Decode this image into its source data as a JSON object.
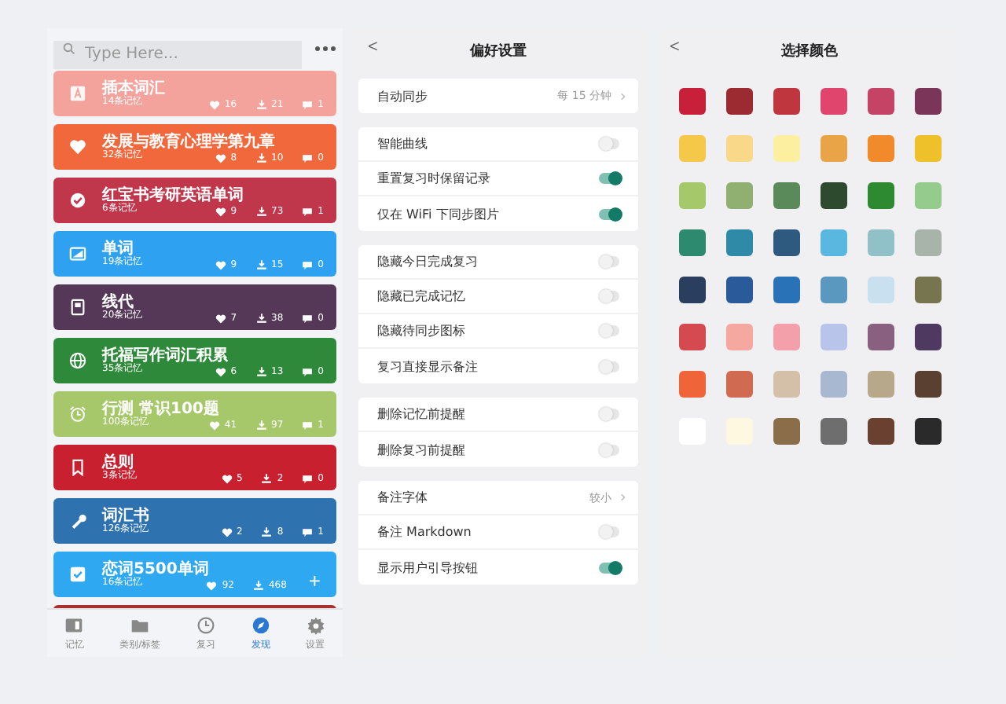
{
  "search": {
    "placeholder": "Type Here..."
  },
  "decks": [
    {
      "title": "插本词汇",
      "count": "14条记忆",
      "likes": "16",
      "downloads": "21",
      "comments": "1",
      "color": "#f4a29c"
    },
    {
      "title": "发展与教育心理学第九章",
      "count": "32条记忆",
      "likes": "8",
      "downloads": "10",
      "comments": "0",
      "color": "#f0683c"
    },
    {
      "title": "红宝书考研英语单词",
      "count": "6条记忆",
      "likes": "9",
      "downloads": "73",
      "comments": "1",
      "color": "#c0364a"
    },
    {
      "title": "单词",
      "count": "19条记忆",
      "likes": "9",
      "downloads": "15",
      "comments": "0",
      "color": "#2ea2f0"
    },
    {
      "title": "线代",
      "count": "20条记忆",
      "likes": "7",
      "downloads": "38",
      "comments": "0",
      "color": "#553858"
    },
    {
      "title": "托福写作词汇积累",
      "count": "35条记忆",
      "likes": "6",
      "downloads": "13",
      "comments": "0",
      "color": "#2e8a3a"
    },
    {
      "title": "行测 常识100题",
      "count": "100条记忆",
      "likes": "41",
      "downloads": "97",
      "comments": "1",
      "color": "#a6c86a"
    },
    {
      "title": "总则",
      "count": "3条记忆",
      "likes": "5",
      "downloads": "2",
      "comments": "0",
      "color": "#c8202e"
    },
    {
      "title": "词汇书",
      "count": "126条记忆",
      "likes": "2",
      "downloads": "8",
      "comments": "1",
      "color": "#2e72b0"
    },
    {
      "title": "恋词5500单词",
      "count": "16条记忆",
      "likes": "92",
      "downloads": "468",
      "color": "#2ea8f0",
      "fab": "+"
    },
    {
      "color": "#a83232"
    }
  ],
  "nav": [
    {
      "label": "记忆",
      "selected": false
    },
    {
      "label": "类别/标签",
      "selected": false
    },
    {
      "label": "复习",
      "selected": false
    },
    {
      "label": "发现",
      "selected": true
    },
    {
      "label": "设置",
      "selected": false
    }
  ],
  "settings": {
    "back": "<",
    "title": "偏好设置",
    "groups": [
      [
        {
          "kind": "value",
          "label": "自动同步",
          "value": "每 15 分钟"
        }
      ],
      [
        {
          "kind": "toggle",
          "label": "智能曲线",
          "on": false
        },
        {
          "kind": "toggle",
          "label": "重置复习时保留记录",
          "on": true
        },
        {
          "kind": "toggle",
          "label": "仅在 WiFi 下同步图片",
          "on": true
        }
      ],
      [
        {
          "kind": "toggle",
          "label": "隐藏今日完成复习",
          "on": false
        },
        {
          "kind": "toggle",
          "label": "隐藏已完成记忆",
          "on": false
        },
        {
          "kind": "toggle",
          "label": "隐藏待同步图标",
          "on": false
        },
        {
          "kind": "toggle",
          "label": "复习直接显示备注",
          "on": false
        }
      ],
      [
        {
          "kind": "toggle",
          "label": "删除记忆前提醒",
          "on": false
        },
        {
          "kind": "toggle",
          "label": "删除复习前提醒",
          "on": false
        }
      ],
      [
        {
          "kind": "value",
          "label": "备注字体",
          "value": "较小"
        },
        {
          "kind": "toggle",
          "label": "备注 Markdown",
          "on": false
        },
        {
          "kind": "toggle",
          "label": "显示用户引导按钮",
          "on": true
        }
      ]
    ]
  },
  "palette": {
    "back": "<",
    "title": "选择颜色",
    "swatches": [
      {
        "color": "#c8203a"
      },
      {
        "color": "#9b2b31"
      },
      {
        "color": "#c0363f"
      },
      {
        "color": "#e0456e"
      },
      {
        "color": "#c54365"
      },
      {
        "color": "#7a3558"
      },
      {
        "color": "#f5c84a"
      },
      {
        "color": "#fad88a"
      },
      {
        "color": "#fcf0a0"
      },
      {
        "color": "#e8a446"
      },
      {
        "color": "#f08a2a"
      },
      {
        "color": "#eec02a"
      },
      {
        "color": "#a5c86a"
      },
      {
        "color": "#8fb070"
      },
      {
        "color": "#5a8a5a"
      },
      {
        "color": "#2e4a2e"
      },
      {
        "color": "#2e8a30"
      },
      {
        "color": "#95cc8e"
      },
      {
        "color": "#2e8a6e"
      },
      {
        "color": "#2e8aa6"
      },
      {
        "color": "#2e5a80"
      },
      {
        "color": "#5ab8e0"
      },
      {
        "color": "#90c0c8"
      },
      {
        "color": "#a8b4aa"
      },
      {
        "color": "#2a3e60"
      },
      {
        "color": "#2a5a9a"
      },
      {
        "color": "#2a72b8"
      },
      {
        "color": "#5a98c0"
      },
      {
        "color": "#c8e0f0"
      },
      {
        "color": "#767550"
      },
      {
        "color": "#d44a50"
      },
      {
        "color": "#f4a8a0"
      },
      {
        "color": "#f4a0aa"
      },
      {
        "color": "#b8c4ea"
      },
      {
        "color": "#8a6080"
      },
      {
        "color": "#4e3a60"
      },
      {
        "color": "#f0643a"
      },
      {
        "color": "#d06a50"
      },
      {
        "color": "#d4c0a8"
      },
      {
        "color": "#a8b8d0"
      },
      {
        "color": "#b8a88a"
      },
      {
        "color": "#5a4030"
      },
      {
        "color": "#ffffff"
      },
      {
        "color": "#fff8e0"
      },
      {
        "color": "#8a6e4a"
      },
      {
        "color": "#6e6e6e"
      },
      {
        "color": "#6a4030"
      },
      {
        "color": "#2a2a2a"
      }
    ]
  }
}
